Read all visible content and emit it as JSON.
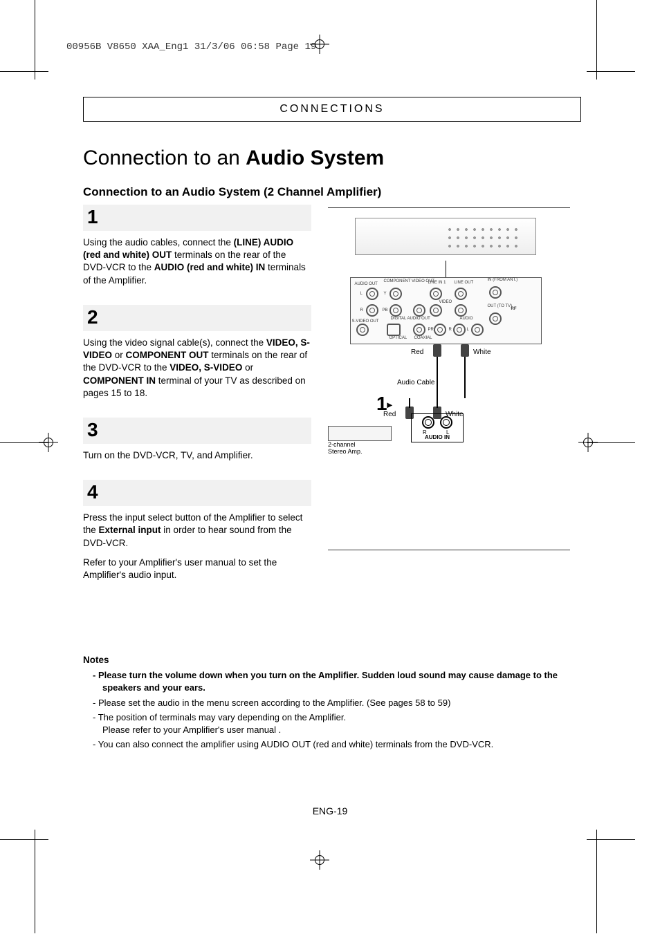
{
  "print_header": "00956B V8650 XAA_Eng1  31/3/06  06:58  Page 19",
  "section_label": "CONNECTIONS",
  "title_light": "Connection to an ",
  "title_bold": "Audio System",
  "subtitle": "Connection to an Audio System (2 Channel Amplifier)",
  "steps": {
    "s1": {
      "num": "1",
      "p1a": "Using the audio cables, connect the ",
      "p1b": "(LINE) AUDIO (red and white) OUT",
      "p1c": " terminals on the rear of the DVD-VCR to the ",
      "p1d": "AUDIO (red and white) IN",
      "p1e": " terminals of the Amplifier."
    },
    "s2": {
      "num": "2",
      "p1a": "Using the video signal cable(s), connect the ",
      "p1b": "VIDEO, S-VIDEO",
      "p1c": " or ",
      "p1d": "COMPONENT OUT",
      "p1e": " terminals on the rear of the DVD-VCR to the ",
      "p1f": "VIDEO, S-VIDEO",
      "p1g": " or ",
      "p1h": "COMPONENT IN",
      "p1i": " terminal of your TV as described on pages 15 to 18."
    },
    "s3": {
      "num": "3",
      "p1": "Turn on the DVD-VCR, TV, and Amplifier."
    },
    "s4": {
      "num": "4",
      "p1a": "Press the input select button of the Amplifier to select the ",
      "p1b": "External input",
      "p1c": " in order to hear sound from the DVD-VCR.",
      "p2": "Refer to your Amplifier's user manual to set the Amplifier's audio input."
    }
  },
  "diagram": {
    "red1": "Red",
    "white1": "White",
    "audio_cable": "Audio Cable",
    "step_num": "1",
    "red2": "Red",
    "white2": "White",
    "amp_label1": "2-channel",
    "amp_label2": "Stereo Amp.",
    "audio_in": "AUDIO IN",
    "r": "R",
    "l": "L",
    "panel": {
      "audio_out": "AUDIO OUT",
      "component": "COMPONENT VIDEO OUT",
      "line_in1": "LINE IN 1",
      "line_out": "LINE OUT",
      "in_ant": "IN (FROM ANT.)",
      "out_tv": "OUT (TO TV)",
      "rf": "RF",
      "svideo": "S-VIDEO OUT",
      "digital": "DIGITAL AUDIO OUT",
      "optical": "OPTICAL",
      "coaxial": "COAXIAL",
      "video": "VIDEO",
      "audio": "AUDIO",
      "L": "L",
      "R": "R",
      "Y": "Y",
      "PB": "PB",
      "PR": "PR"
    }
  },
  "notes": {
    "heading": "Notes",
    "n1": "Please turn the volume down when you turn on the Amplifier. Sudden loud sound may cause  damage to the speakers and your ears.",
    "n2": "Please set the audio in the menu screen according to the Amplifier. (See pages 58 to 59)",
    "n3a": "The position of terminals may vary depending on the Amplifier.",
    "n3b": "Please refer to your Amplifier's user manual .",
    "n4": "You can also connect the amplifier using AUDIO OUT (red and white) terminals from the DVD-VCR."
  },
  "page_num": "ENG-19"
}
